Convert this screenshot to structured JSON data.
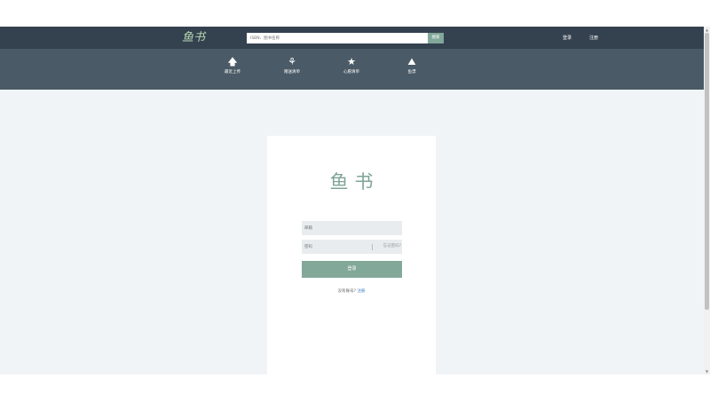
{
  "header": {
    "logo": "鱼书",
    "search": {
      "placeholder": "ISBN、图书名称",
      "button": "搜索"
    },
    "links": {
      "login": "登录",
      "register": "注册"
    }
  },
  "nav": {
    "items": [
      {
        "icon": "arrow-up-icon",
        "glyph": "🡅",
        "label": "最近上传"
      },
      {
        "icon": "gift-icon",
        "glyph": "⚘",
        "label": "赠送清单"
      },
      {
        "icon": "star-icon",
        "glyph": "★",
        "label": "心愿清单"
      },
      {
        "icon": "mountain-icon",
        "glyph": "⛰",
        "label": "鱼漂"
      }
    ]
  },
  "login_card": {
    "title": "鱼书",
    "email_placeholder": "邮箱",
    "password_placeholder": "密码",
    "forgot_password": "忘记密码?",
    "login_button": "登录",
    "register_prompt": "没有账号?",
    "register_link": "注册"
  },
  "scrollbar": {
    "up": "▲",
    "down": "▼"
  },
  "colors": {
    "header_bg": "#34424f",
    "nav_bg": "#4a5a66",
    "accent": "#82a89a",
    "page_bg": "#f0f4f7",
    "link": "#3b7fc4"
  }
}
